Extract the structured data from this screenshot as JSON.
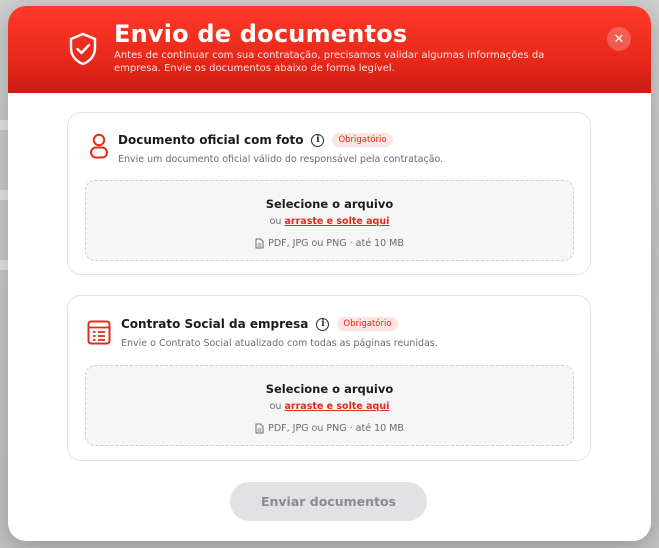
{
  "colors": {
    "brand": "#e8281a",
    "badge_bg": "#fde4e1",
    "badge_text": "#e02b1c"
  },
  "header": {
    "title": "Envio de documentos",
    "subtitle": "Antes de continuar com sua contratação, precisamos validar algumas informações da empresa. Envie os documentos abaixo de forma legível.",
    "icon": "shield-check-icon",
    "close_icon": "close-icon"
  },
  "documents": [
    {
      "icon": "person-icon",
      "title": "Documento oficial com foto",
      "badge": "Obrigatório",
      "description": "Envie um documento oficial válido do responsável pela contratação.",
      "dropzone": {
        "select_label": "Selecione o arquivo",
        "or_label": "ou",
        "drag_label": "arraste e solte aqui",
        "formats": "PDF, JPG ou PNG · até 10 MB"
      }
    },
    {
      "icon": "document-list-icon",
      "title": "Contrato Social da empresa",
      "badge": "Obrigatório",
      "description": "Envie o Contrato Social atualizado com todas as páginas reunidas.",
      "dropzone": {
        "select_label": "Selecione o arquivo",
        "or_label": "ou",
        "drag_label": "arraste e solte aqui",
        "formats": "PDF, JPG ou PNG · até 10 MB"
      }
    }
  ],
  "submit_label": "Enviar documentos"
}
